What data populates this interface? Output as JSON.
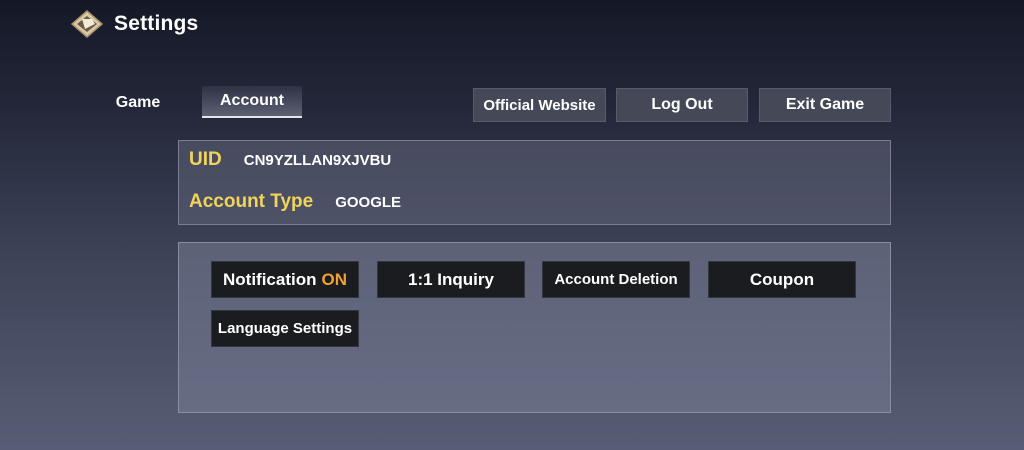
{
  "header": {
    "title": "Settings",
    "logo_icon": "diamond-emblem-icon"
  },
  "tabs": [
    {
      "label": "Game",
      "active": false
    },
    {
      "label": "Account",
      "active": true
    }
  ],
  "actions": {
    "official_website": "Official Website",
    "log_out": "Log Out",
    "exit_game": "Exit Game"
  },
  "account": {
    "uid_label": "UID",
    "uid_value": "CN9YZLLAN9XJVBU",
    "type_label": "Account Type",
    "type_value": "GOOGLE"
  },
  "options": {
    "notification_label": "Notification",
    "notification_status": "ON",
    "inquiry": "1:1 Inquiry",
    "account_deletion": "Account Deletion",
    "coupon": "Coupon",
    "language_settings": "Language Settings"
  },
  "colors": {
    "label_yellow": "#f1d45a",
    "status_orange": "#f0a030",
    "button_dark": "#1b1c20",
    "button_gray": "#454957"
  }
}
